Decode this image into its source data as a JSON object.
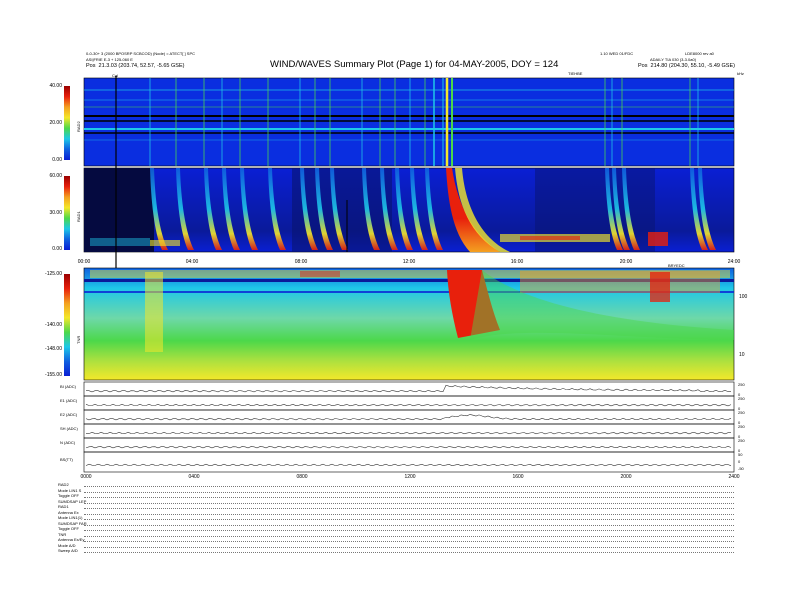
{
  "header": {
    "left_line1": "0-0-30+ 3 (2000 BPOSRP SCBCOD) (Node) = ATECT[ ] SPC",
    "left_line2": "ASI|FRIE E-3 + 125-060 E",
    "left_pos": "Pos",
    "left_coords": "21.3.03 (203.74, 52.57, -5.65 GSE)",
    "title": "WIND/WAVES Summary Plot (Page 1) for 04-MAY-2005, DOY = 124",
    "right_line1": "1.10 WED 01/FDC",
    "right_line2": "ADAILY TIA 030 (3-3.0a0)",
    "right_pos": "Pos",
    "right_coords": "214.80 (204.30, 55.10, -5.49 GSE)",
    "right_id": "LDE8000 rev a0",
    "marker_label": "Cal",
    "ticks_label_top": "TIEHBE",
    "ticks_label_tnr": "BRYEDC",
    "corner_label": "kHz"
  },
  "panels": {
    "rad2": {
      "name": "RAD2",
      "ticks": [
        "40.00",
        "20.00",
        "0.00"
      ]
    },
    "rad1": {
      "name": "RAD1",
      "ticks": [
        "60.00",
        "30.00",
        "0.00"
      ]
    },
    "tnr": {
      "name": "TNR",
      "ticks": [
        "-125.00",
        "-140.00",
        "-148.00",
        "-155.00"
      ],
      "right_ticks": [
        "100",
        "10"
      ]
    }
  },
  "x_axis_top": [
    "00:00",
    "04:00",
    "08:00",
    "12:00",
    "16:00",
    "20:00",
    "24:00"
  ],
  "x_axis_bottom": [
    "0000",
    "0400",
    "0800",
    "1200",
    "1600",
    "2000",
    "2400"
  ],
  "line_panels": [
    {
      "name": "BI (ADC)",
      "right": [
        "250",
        "0"
      ]
    },
    {
      "name": "E1 (ADC)",
      "right": [
        "250",
        "0"
      ]
    },
    {
      "name": "E2 (ADC)",
      "right": [
        "250",
        "0"
      ]
    },
    {
      "name": "SH (ADC)",
      "right": [
        "250",
        "0"
      ]
    },
    {
      "name": "N (ADC)",
      "right": [
        "250",
        "0"
      ]
    },
    {
      "name": "BS(TT)",
      "right": [
        "50",
        "0",
        "-50"
      ]
    }
  ],
  "params": [
    "RAD2",
    "Mode    LIN1 S",
    "Toggle  OFF",
    "SUMDSAP LEP",
    "RAD1",
    "Antenna  Ex",
    "Mode  LIN1(1)",
    "SUMDSAP FAR",
    "Toggle  OFF",
    "TNR",
    "Antenna  Ex/Ey",
    "Mode  A/D",
    "Sweep  A/D"
  ],
  "colors": {
    "deep_blue": "#0a1fd4",
    "cyan": "#1ec8e8",
    "green": "#4cd84a",
    "yellow": "#f4e82a",
    "red": "#e8200c",
    "dark_red": "#9a0000"
  }
}
